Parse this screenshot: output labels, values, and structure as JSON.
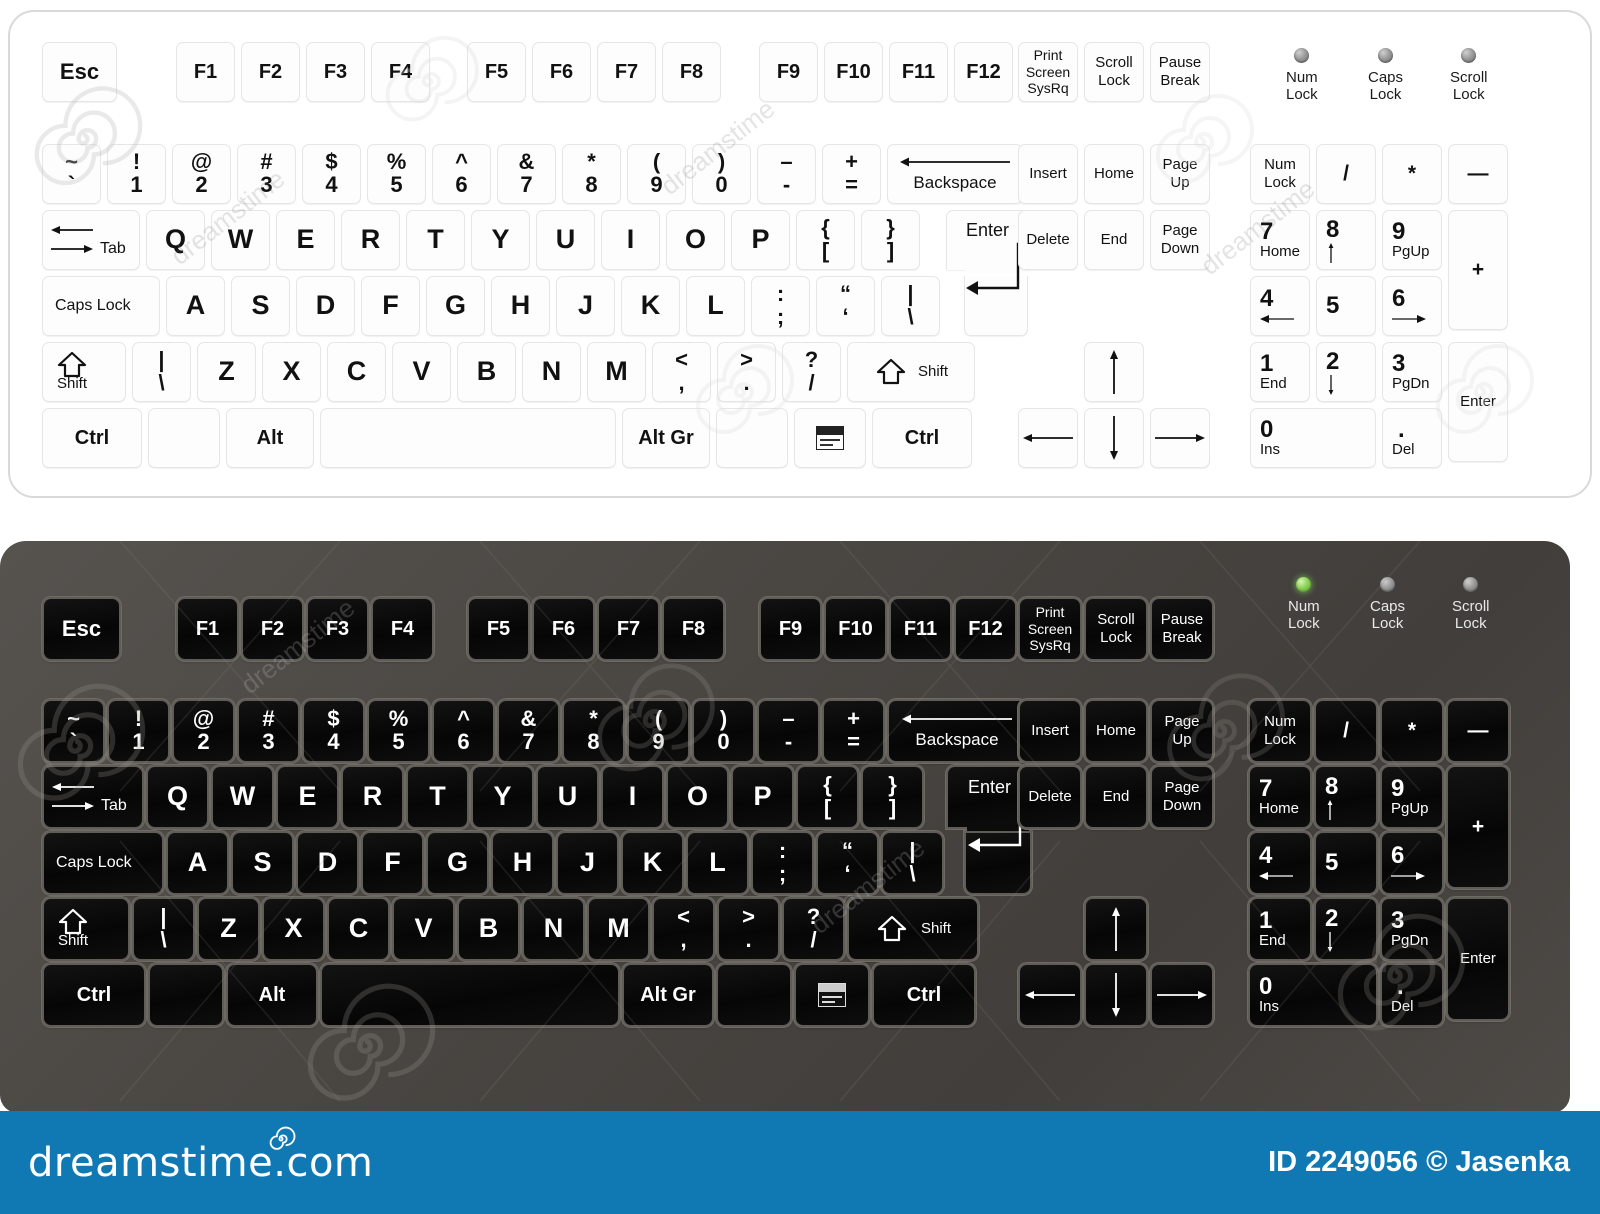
{
  "image": {
    "title": "Computer keyboard illustration - white and black variants",
    "footer": {
      "brand": "dreamstime.com",
      "credit": "ID 2249056 © Jasenka",
      "banner_color": "#1079b4"
    },
    "watermark_text": "dreamstime"
  },
  "colors": {
    "white_body": "#ffffff",
    "white_key": "#fdfdfd",
    "white_key_border": "#e6e6e6",
    "white_text": "#111111",
    "black_body": "#4a4743",
    "black_key": "#0b0b0b",
    "black_key_border": "#605c57",
    "black_text": "#ffffff",
    "led_off": "#9b9b9b",
    "led_on": "#8ed45a"
  },
  "keyboards": [
    {
      "id": "white",
      "theme": "white",
      "num_lock_led": "off",
      "caps_lock_led": "off",
      "scroll_lock_led": "off"
    },
    {
      "id": "black",
      "theme": "black",
      "num_lock_led": "on",
      "caps_lock_led": "off",
      "scroll_lock_led": "off"
    }
  ],
  "layout": {
    "function_row": {
      "esc": "Esc",
      "group1": [
        "F1",
        "F2",
        "F3",
        "F4"
      ],
      "group2": [
        "F5",
        "F6",
        "F7",
        "F8"
      ],
      "group3": [
        "F9",
        "F10",
        "F11",
        "F12"
      ]
    },
    "number_row": [
      {
        "top": "~",
        "bottom": "`"
      },
      {
        "top": "!",
        "bottom": "1"
      },
      {
        "top": "@",
        "bottom": "2"
      },
      {
        "top": "#",
        "bottom": "3"
      },
      {
        "top": "$",
        "bottom": "4"
      },
      {
        "top": "%",
        "bottom": "5"
      },
      {
        "top": "^",
        "bottom": "6"
      },
      {
        "top": "&",
        "bottom": "7"
      },
      {
        "top": "*",
        "bottom": "8"
      },
      {
        "top": "(",
        "bottom": "9"
      },
      {
        "top": ")",
        "bottom": "0"
      },
      {
        "top": "–",
        "bottom": "-"
      },
      {
        "top": "+",
        "bottom": "="
      }
    ],
    "backspace": "Backspace",
    "tab": "Tab",
    "qwerty_row": [
      "Q",
      "W",
      "E",
      "R",
      "T",
      "Y",
      "U",
      "I",
      "O",
      "P"
    ],
    "qwerty_brackets": [
      {
        "top": "{",
        "bottom": "["
      },
      {
        "top": "}",
        "bottom": "]"
      }
    ],
    "enter": "Enter",
    "caps_lock": "Caps Lock",
    "home_row": [
      "A",
      "S",
      "D",
      "F",
      "G",
      "H",
      "J",
      "K",
      "L"
    ],
    "home_row_symbols": [
      {
        "top": ":",
        "bottom": ";"
      },
      {
        "top": "“",
        "bottom": "‘"
      },
      {
        "top": "|",
        "bottom": "\\"
      }
    ],
    "shift": "Shift",
    "shift_extra": {
      "top": "|",
      "bottom": "\\"
    },
    "bottom_row_letters": [
      "Z",
      "X",
      "C",
      "V",
      "B",
      "N",
      "M"
    ],
    "bottom_row_symbols": [
      {
        "top": "<",
        "bottom": ","
      },
      {
        "top": ">",
        "bottom": "."
      },
      {
        "top": "?",
        "bottom": "/"
      }
    ],
    "ctrl": "Ctrl",
    "alt": "Alt",
    "alt_gr": "Alt Gr",
    "space": "",
    "menu_icon": "menu-icon",
    "nav_cluster": {
      "print_screen": [
        "Print",
        "Screen",
        "SysRq"
      ],
      "scroll_lock": [
        "Scroll",
        "Lock"
      ],
      "pause_break": [
        "Pause",
        "Break"
      ],
      "insert": "Insert",
      "home": "Home",
      "page_up": [
        "Page",
        "Up"
      ],
      "delete": "Delete",
      "end": "End",
      "page_down": [
        "Page",
        "Down"
      ]
    },
    "leds": [
      {
        "name": "Num",
        "name2": "Lock"
      },
      {
        "name": "Caps",
        "name2": "Lock"
      },
      {
        "name": "Scroll",
        "name2": "Lock"
      }
    ],
    "numpad": {
      "num_lock": [
        "Num",
        "Lock"
      ],
      "divide": "/",
      "multiply": "*",
      "minus": "—",
      "plus": "+",
      "enter": "Enter",
      "keys": [
        {
          "n": "7",
          "s": "Home"
        },
        {
          "n": "8",
          "s": "arrow-up-icon"
        },
        {
          "n": "9",
          "s": "PgUp"
        },
        {
          "n": "4",
          "s": "arrow-left-icon"
        },
        {
          "n": "5",
          "s": ""
        },
        {
          "n": "6",
          "s": "arrow-right-icon"
        },
        {
          "n": "1",
          "s": "End"
        },
        {
          "n": "2",
          "s": "arrow-down-icon"
        },
        {
          "n": "3",
          "s": "PgDn"
        },
        {
          "n": "0",
          "s": "Ins"
        },
        {
          "n": ".",
          "s": "Del"
        }
      ]
    },
    "arrow_cluster": [
      "arrow-up-icon",
      "arrow-left-icon",
      "arrow-down-icon",
      "arrow-right-icon"
    ]
  }
}
